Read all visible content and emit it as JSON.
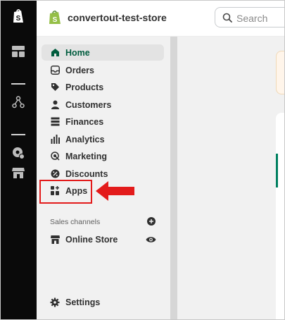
{
  "store": {
    "name": "convertout-test-store"
  },
  "search": {
    "placeholder": "Search"
  },
  "rail": {
    "icons": [
      "shopify-logo-icon",
      "dashboard-icon",
      "flow-icon",
      "settings-icon",
      "store-icon"
    ]
  },
  "nav": {
    "items": [
      {
        "label": "Home",
        "icon": "home-icon",
        "active": true
      },
      {
        "label": "Orders",
        "icon": "orders-icon"
      },
      {
        "label": "Products",
        "icon": "tag-icon"
      },
      {
        "label": "Customers",
        "icon": "person-icon"
      },
      {
        "label": "Finances",
        "icon": "bank-icon"
      },
      {
        "label": "Analytics",
        "icon": "bar-chart-icon"
      },
      {
        "label": "Marketing",
        "icon": "target-icon"
      },
      {
        "label": "Discounts",
        "icon": "discount-icon"
      },
      {
        "label": "Apps",
        "icon": "apps-icon",
        "highlighted": true
      }
    ],
    "sales_channels_label": "Sales channels",
    "online_store_label": "Online Store",
    "settings_label": "Settings"
  },
  "colors": {
    "active_green": "#005c3e",
    "shopify_green": "#95bf47",
    "annotation_red": "#e31b1b",
    "rail_bg": "#0a0a0a",
    "sidebar_bg": "#f1f1f1"
  }
}
